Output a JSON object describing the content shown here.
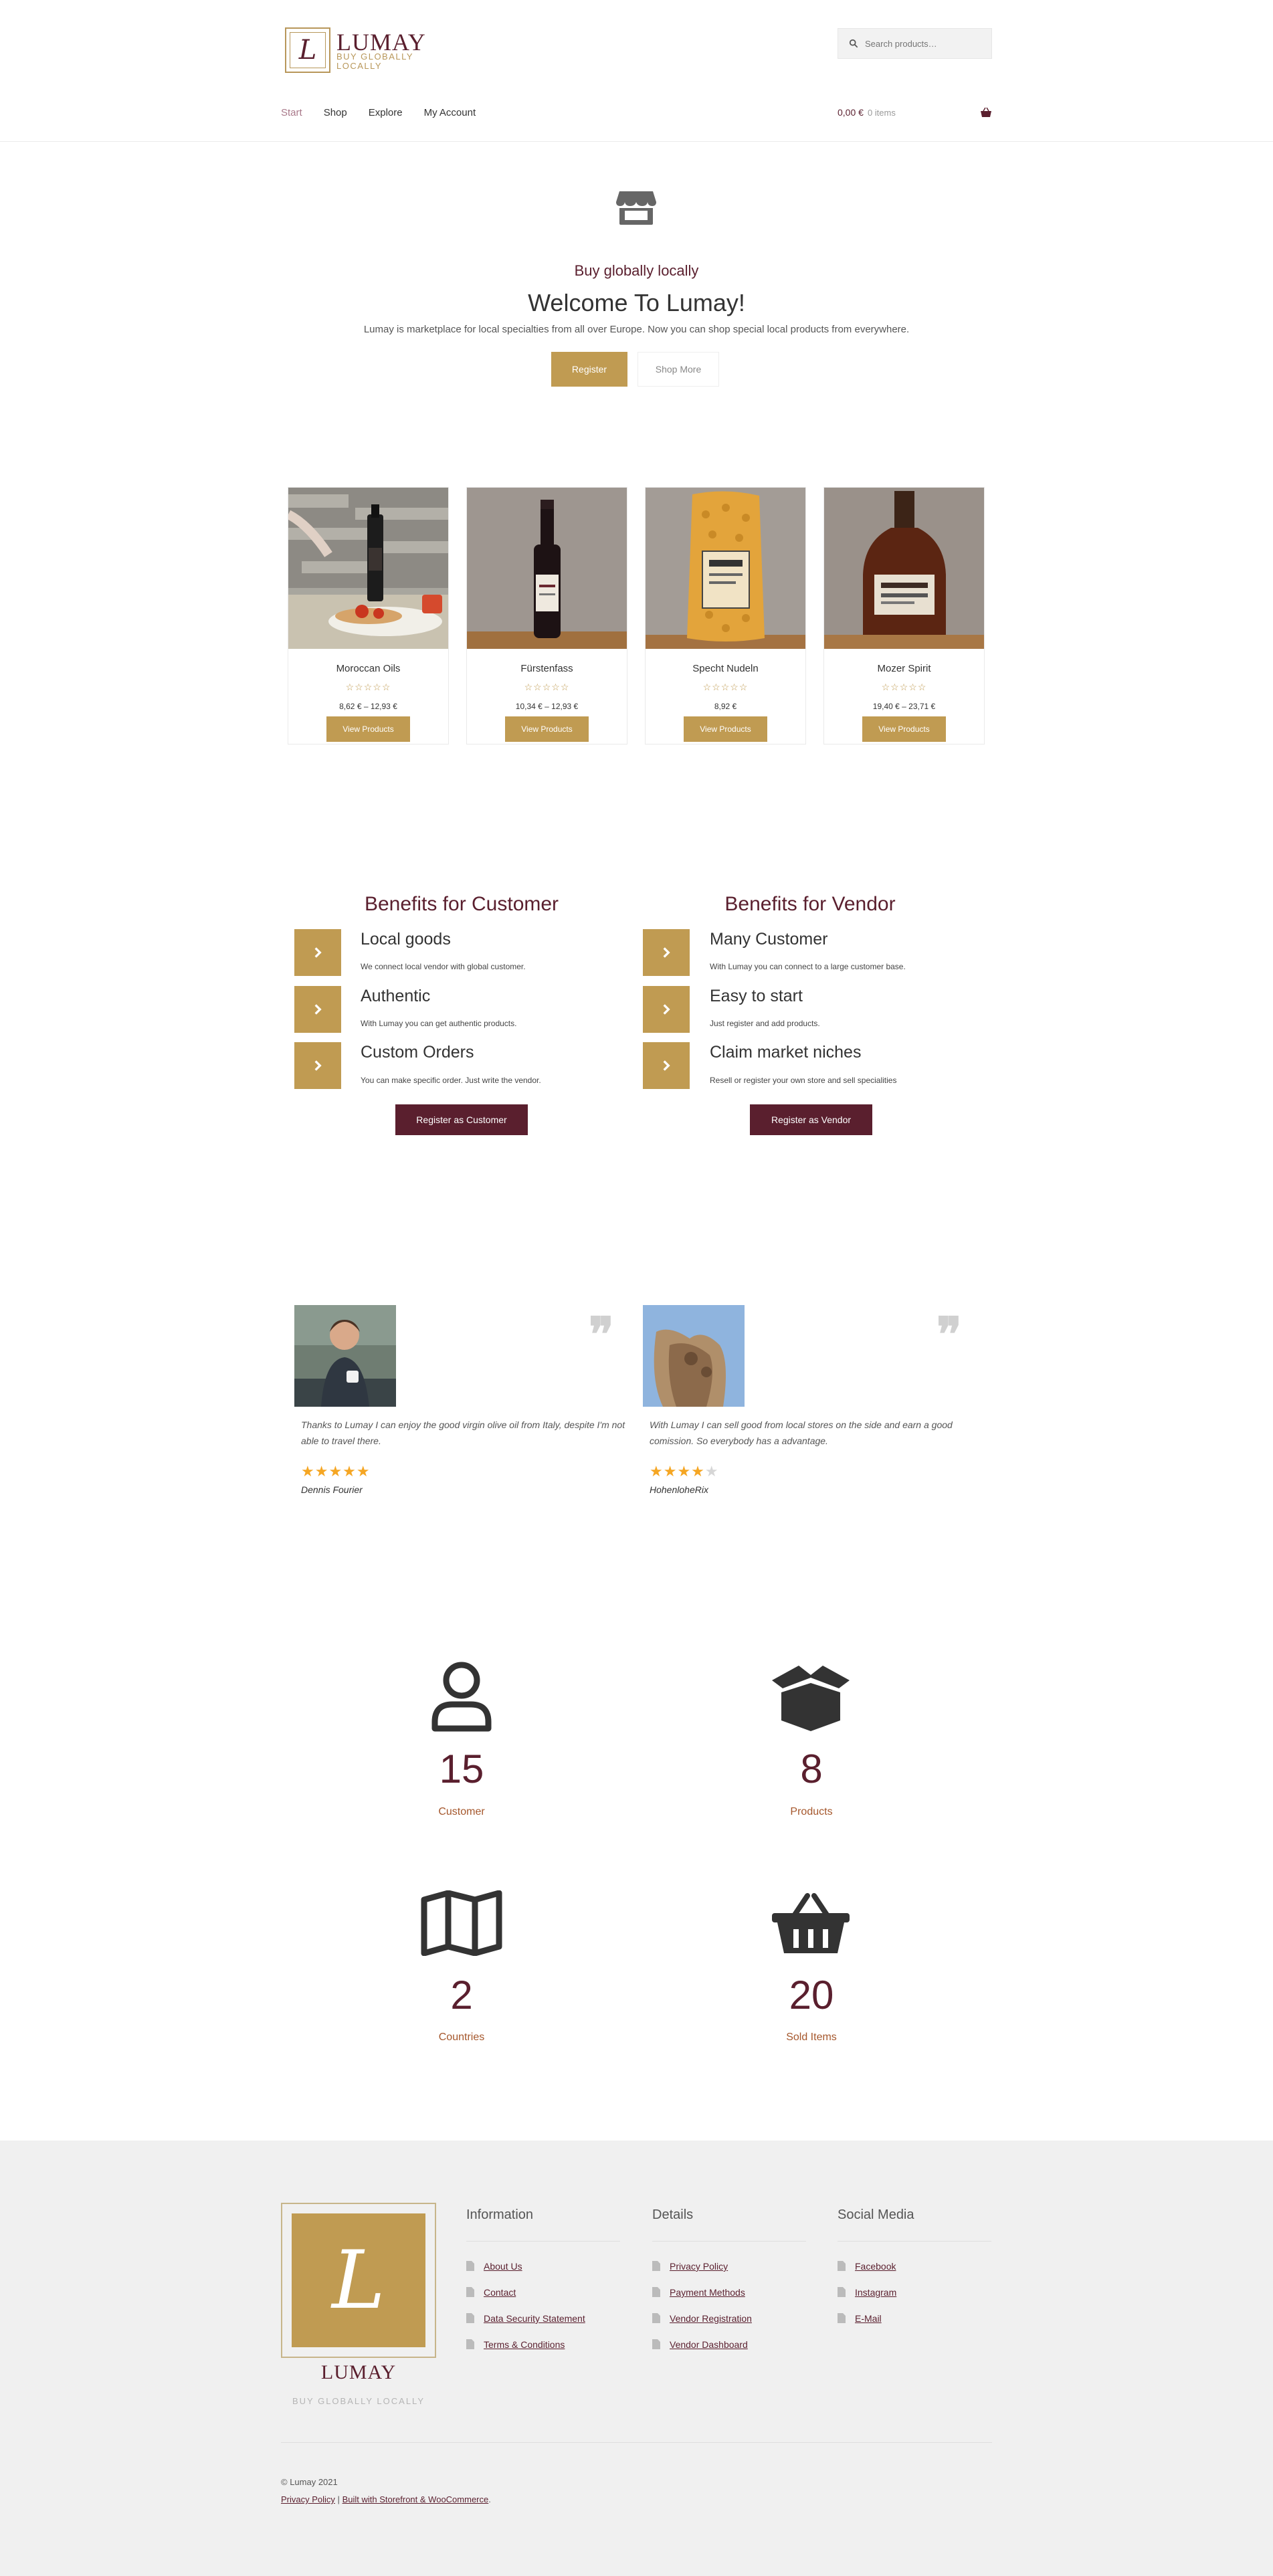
{
  "brand": {
    "logo_letter": "L",
    "name": "LUMAY",
    "tagline": "BUY GLOBALLY LOCALLY"
  },
  "search": {
    "placeholder": "Search products…"
  },
  "nav": {
    "items": [
      "Start",
      "Shop",
      "Explore",
      "My Account"
    ],
    "active": "Start"
  },
  "cart": {
    "amount": "0,00 €",
    "items": "0 items"
  },
  "hero": {
    "subtitle": "Buy globally locally",
    "title": "Welcome To Lumay!",
    "text": "Lumay is marketplace for local specialties from all over Europe. Now you can shop special local products from everywhere.",
    "register_label": "Register",
    "shop_label": "Shop More"
  },
  "products": [
    {
      "name": "Moroccan Oils",
      "price": "8,62 € – 12,93 €",
      "stars": "☆☆☆☆☆",
      "button": "View Products"
    },
    {
      "name": "Fürstenfass",
      "price": "10,34 € – 12,93 €",
      "stars": "☆☆☆☆☆",
      "button": "View Products"
    },
    {
      "name": "Specht Nudeln",
      "price": "8,92 €",
      "stars": "☆☆☆☆☆",
      "button": "View Products"
    },
    {
      "name": "Mozer Spirit",
      "price": "19,40 € – 23,71 €",
      "stars": "☆☆☆☆☆",
      "button": "View Products"
    }
  ],
  "benefits": {
    "customer": {
      "title": "Benefits for Customer",
      "items": [
        {
          "heading": "Local goods",
          "text": "We connect local vendor with global customer."
        },
        {
          "heading": "Authentic",
          "text": "With Lumay you can get authentic products."
        },
        {
          "heading": "Custom Orders",
          "text": "You can make specific order. Just write the vendor."
        }
      ],
      "button": "Register as Customer"
    },
    "vendor": {
      "title": "Benefits for Vendor",
      "items": [
        {
          "heading": "Many Customer",
          "text": "With Lumay you can connect to a large customer base."
        },
        {
          "heading": "Easy to start",
          "text": "Just register and add products."
        },
        {
          "heading": "Claim market niches",
          "text": "Resell or register your own store and sell specialities"
        }
      ],
      "button": "Register as Vendor"
    }
  },
  "testimonials": [
    {
      "text": "Thanks to Lumay I can enjoy the good virgin olive oil from Italy, despite I'm not able to travel there.",
      "name": "Dennis Fourier",
      "rating": 5,
      "quote_mark": "❞"
    },
    {
      "text": "With Lumay I can sell good from local stores on the side and earn a good comission. So everybody has a advantage.",
      "name": "HohenloheRix",
      "rating": 4,
      "quote_mark": "❞"
    }
  ],
  "stats": [
    {
      "icon": "user-icon",
      "value": "15",
      "label": "Customer"
    },
    {
      "icon": "box-icon",
      "value": "8",
      "label": "Products"
    },
    {
      "icon": "map-icon",
      "value": "2",
      "label": "Countries"
    },
    {
      "icon": "basket-icon",
      "value": "20",
      "label": "Sold Items"
    }
  ],
  "footer": {
    "columns": [
      {
        "title": "Information",
        "links": [
          "About Us",
          "Contact",
          "Data Security Statement",
          "Terms & Conditions"
        ]
      },
      {
        "title": "Details",
        "links": [
          "Privacy Policy",
          "Payment Methods",
          "Vendor Registration",
          "Vendor Dashboard"
        ]
      },
      {
        "title": "Social Media",
        "links": [
          "Facebook",
          "Instagram",
          "E-Mail"
        ]
      }
    ],
    "copyright": "© Lumay 2021",
    "privacy": "Privacy Policy",
    "separator": "|",
    "built_with": "Built with Storefront & WooCommerce",
    "period": "."
  },
  "colors": {
    "gold": "#c09b52",
    "maroon": "#5a1f2e",
    "footer_bg": "#f0f0f0"
  }
}
